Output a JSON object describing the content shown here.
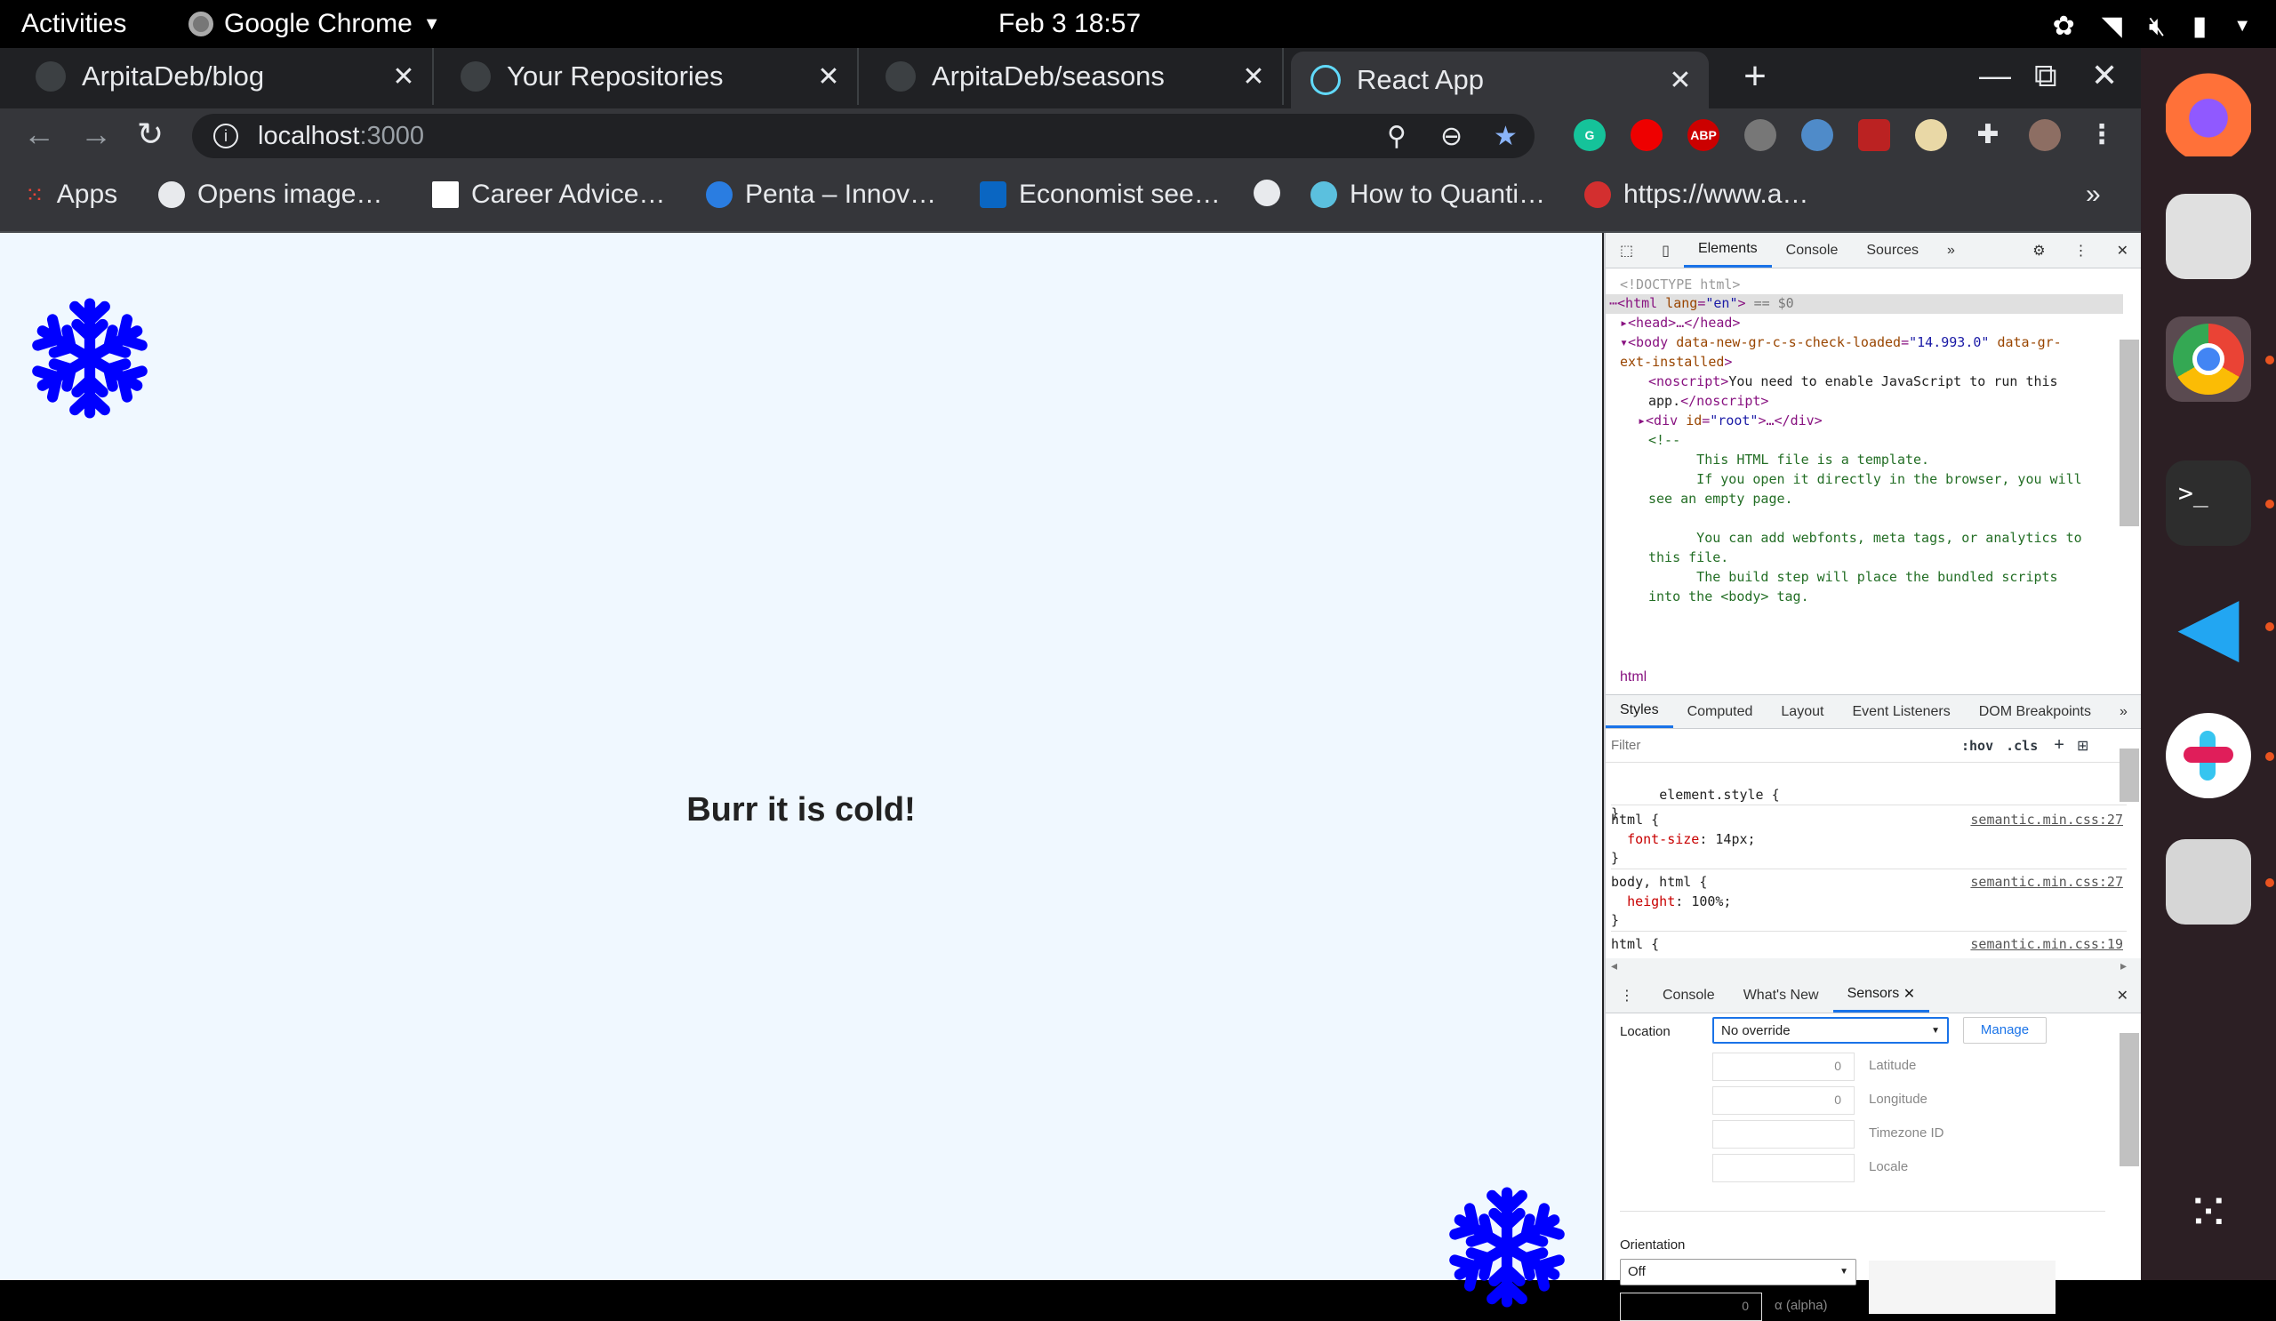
{
  "system": {
    "activities": "Activities",
    "app_name": "Google Chrome",
    "clock": "Feb 3  18:57"
  },
  "tabs": [
    {
      "title": "ArpitaDeb/blog"
    },
    {
      "title": "Your Repositories"
    },
    {
      "title": "ArpitaDeb/seasons"
    },
    {
      "title": "React App"
    }
  ],
  "address": {
    "host": "localhost",
    "port": ":3000"
  },
  "extensions": [
    "G",
    "ABP"
  ],
  "bookmarks": [
    "Apps",
    "Opens image…",
    "Career Advice…",
    "Penta – Innov…",
    "Economist see…",
    "How to Quanti…",
    "https://www.a…"
  ],
  "page": {
    "message": "Burr it is cold!"
  },
  "devtools": {
    "top_tabs": [
      "Elements",
      "Console",
      "Sources"
    ],
    "breadcrumb": "html",
    "style_tabs": [
      "Styles",
      "Computed",
      "Layout",
      "Event Listeners",
      "DOM Breakpoints"
    ],
    "filter_placeholder": "Filter",
    "hov": ":hov",
    "cls": ".cls",
    "drawer_tabs": [
      "Console",
      "What's New",
      "Sensors"
    ],
    "sensors": {
      "location_label": "Location",
      "location_value": "No override",
      "manage": "Manage",
      "latitude_value": "0",
      "latitude_label": "Latitude",
      "longitude_value": "0",
      "longitude_label": "Longitude",
      "timezone_label": "Timezone ID",
      "locale_label": "Locale",
      "orientation_label": "Orientation",
      "orientation_value": "Off",
      "alpha_value": "0",
      "alpha_label": "α (alpha)"
    },
    "css_rules": [
      {
        "selector": "html {",
        "prop": "font-size",
        "value": "14px;",
        "source": "semantic.min.css:27"
      },
      {
        "selector": "body, html {",
        "prop": "height",
        "value": "100%;",
        "source": "semantic.min.css:27"
      },
      {
        "selector": "html {",
        "prop": "",
        "value": "",
        "source": "semantic.min.css:19"
      }
    ],
    "element_style": "element.style {"
  },
  "colors": {
    "page_bg": "#f0f8ff",
    "flake": "#0000ff",
    "accent": "#1a73e8"
  }
}
